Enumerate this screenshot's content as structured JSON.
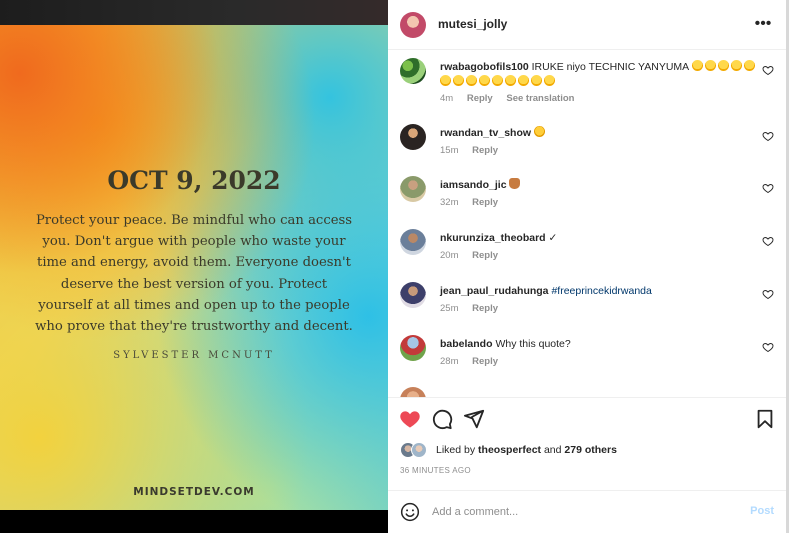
{
  "post": {
    "date": "OCT 9, 2022",
    "quote": "Protect your peace. Be mindful who can access you. Don't argue with people who waste your time and energy, avoid them. Everyone doesn't deserve the best version of you. Protect yourself at all times and  open up to the people who prove that they're trustworthy and decent.",
    "author": "SYLVESTER MCNUTT",
    "site": "MINDSETDEV.COM"
  },
  "header": {
    "username": "mutesi_jolly",
    "more_icon": "more-horizontal-icon",
    "more_glyph": "•••"
  },
  "comments": [
    {
      "username": "rwabagobofils100",
      "text": "IRUKE niyo TECHNIC YANYUMA",
      "emoji": "grinning-face-emoji",
      "emoji_count": 14,
      "time": "4m",
      "reply": "Reply",
      "translate": "See translation"
    },
    {
      "username": "rwandan_tv_show",
      "text": "",
      "emoji": "heart-eyes-emoji",
      "emoji_count": 1,
      "time": "15m",
      "reply": "Reply"
    },
    {
      "username": "iamsando_jic",
      "text": "",
      "emoji": "writing-hand-emoji",
      "emoji_count": 1,
      "time": "32m",
      "reply": "Reply"
    },
    {
      "username": "nkurunziza_theobard",
      "text": "✓",
      "time": "20m",
      "reply": "Reply"
    },
    {
      "username": "jean_paul_rudahunga",
      "text": "#freeprincekidrwanda",
      "time": "25m",
      "reply": "Reply"
    },
    {
      "username": "babelando",
      "text": "Why this quote?",
      "time": "28m",
      "reply": "Reply"
    }
  ],
  "actions": {
    "like_icon": "heart-filled-icon",
    "comment_icon": "comment-bubble-icon",
    "share_icon": "paper-plane-icon",
    "save_icon": "bookmark-icon",
    "like_color": "#ed4956"
  },
  "likes": {
    "prefix": "Liked by",
    "user": "theosperfect",
    "and": "and",
    "others": "279 others"
  },
  "timestamp": "36 MINUTES AGO",
  "add_comment": {
    "placeholder": "Add a comment...",
    "post_label": "Post"
  }
}
